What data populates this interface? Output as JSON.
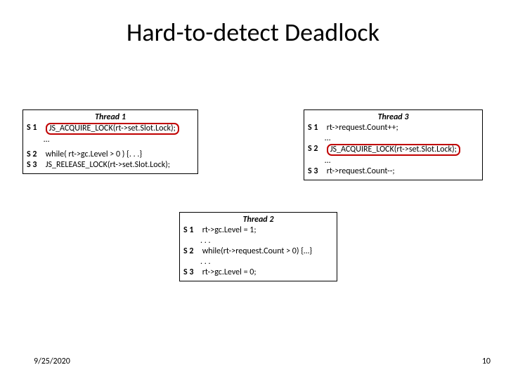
{
  "title": "Hard-to-detect Deadlock",
  "thread1": {
    "header": "Thread 1",
    "l1_num": "S 1",
    "l1_code": "JS_ACQUIRE_LOCK(rt->set.Slot.Lock);",
    "l2_code": "…",
    "l3_num": "S 2",
    "l3_code": "while( rt->gc.Level > 0 ) {. . .}",
    "l4_num": "S 3",
    "l4_code": "JS_RELEASE_LOCK(rt->set.Slot.Lock);"
  },
  "thread3": {
    "header": "Thread 3",
    "l1_num": "S 1",
    "l1_code": "rt->request.Count++;",
    "l2_code": "…",
    "l3_num": "S 2",
    "l3_code": "JS_ACQUIRE_LOCK(rt->set.Slot.Lock);",
    "l4_code": "…",
    "l5_num": "S 3",
    "l5_code": "rt->request.Count--;"
  },
  "thread2": {
    "header": "Thread 2",
    "l1_num": "S 1",
    "l1_code": "rt->gc.Level = 1;",
    "l2_code": ". . .",
    "l3_num": "S 2",
    "l3_code": "while(rt->request.Count > 0) {…}",
    "l4_code": ". . .",
    "l5_num": "S 3",
    "l5_code": "rt->gc.Level = 0;"
  },
  "footer": {
    "date": "9/25/2020",
    "page": "10"
  }
}
